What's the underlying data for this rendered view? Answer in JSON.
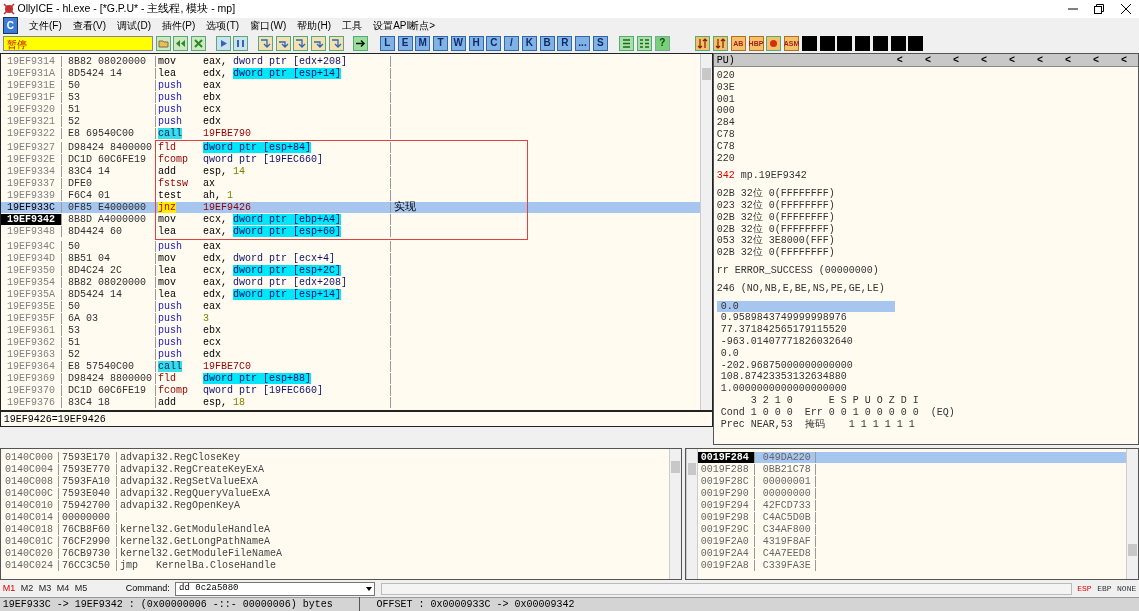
{
  "window": {
    "title": "OllyICE - hl.exe - [*G.P.U* - 主线程, 模块 - mp]"
  },
  "menu": {
    "icon_label": "C",
    "items": [
      "文件(F)",
      "查看(V)",
      "调试(D)",
      "插件(P)",
      "选项(T)",
      "窗口(W)",
      "帮助(H)",
      "工具",
      "设置API断点>"
    ]
  },
  "toolbar": {
    "status": "暂停",
    "letter_buttons": [
      "L",
      "E",
      "M",
      "T",
      "W",
      "H",
      "C",
      "/",
      "K",
      "B",
      "R",
      "...",
      "S"
    ],
    "help_button": "?",
    "plugin_buttons": [
      {
        "kind": "icon"
      },
      {
        "kind": "icon"
      },
      {
        "kind": "text",
        "label": "AB"
      },
      {
        "kind": "text",
        "label": "HBP"
      },
      {
        "kind": "icon"
      },
      {
        "kind": "text",
        "label": "ASM"
      }
    ]
  },
  "disassembly": {
    "rows": [
      {
        "address": "19EF9314",
        "hex": "8B82 08020000",
        "mnemonic": "mov",
        "kind": "plain",
        "operand": [
          {
            "text": "eax, ",
            "kind": "reg"
          },
          {
            "text": "dword ptr [edx+208]",
            "kind": "mem"
          }
        ],
        "selected": false,
        "current": false
      },
      {
        "address": "19EF931A",
        "hex": "8D5424 14",
        "mnemonic": "lea",
        "kind": "plain",
        "operand": [
          {
            "text": "edx, ",
            "kind": "reg"
          },
          {
            "text": "dword ptr [esp+14]",
            "kind": "hl"
          }
        ],
        "selected": false,
        "current": false
      },
      {
        "address": "19EF931E",
        "hex": "50",
        "mnemonic": "push",
        "kind": "push",
        "operand": [
          {
            "text": "eax",
            "kind": "reg"
          }
        ],
        "selected": false,
        "current": false
      },
      {
        "address": "19EF931F",
        "hex": "53",
        "mnemonic": "push",
        "kind": "push",
        "operand": [
          {
            "text": "ebx",
            "kind": "reg"
          }
        ],
        "selected": false,
        "current": false
      },
      {
        "address": "19EF9320",
        "hex": "51",
        "mnemonic": "push",
        "kind": "push",
        "operand": [
          {
            "text": "ecx",
            "kind": "reg"
          }
        ],
        "selected": false,
        "current": false
      },
      {
        "address": "19EF9321",
        "hex": "52",
        "mnemonic": "push",
        "kind": "push",
        "operand": [
          {
            "text": "edx",
            "kind": "reg"
          }
        ],
        "selected": false,
        "current": false
      },
      {
        "address": "19EF9322",
        "hex": "E8 69540C00",
        "mnemonic": "call",
        "kind": "call",
        "operand": [
          {
            "text": "19FBE790",
            "kind": "addr"
          }
        ],
        "selected": false,
        "current": false
      },
      {
        "address": "19EF9327",
        "hex": "D98424 8400000",
        "mnemonic": "fld",
        "kind": "fpu",
        "operand": [
          {
            "text": "dword ptr [esp+84]",
            "kind": "hl"
          }
        ],
        "selected": false,
        "current": false
      },
      {
        "address": "19EF932E",
        "hex": "DC1D 60C6FE19",
        "mnemonic": "fcomp",
        "kind": "fpu",
        "operand": [
          {
            "text": "qword ptr [19FEC660]",
            "kind": "mem"
          }
        ],
        "selected": false,
        "current": false
      },
      {
        "address": "19EF9334",
        "hex": "83C4 14",
        "mnemonic": "add",
        "kind": "plain",
        "operand": [
          {
            "text": "esp, ",
            "kind": "reg"
          },
          {
            "text": "14",
            "kind": "num"
          }
        ],
        "selected": false,
        "current": false
      },
      {
        "address": "19EF9337",
        "hex": "DFE0",
        "mnemonic": "fstsw",
        "kind": "fpu",
        "operand": [
          {
            "text": "ax",
            "kind": "reg"
          }
        ],
        "selected": false,
        "current": false
      },
      {
        "address": "19EF9339",
        "hex": "F6C4 01",
        "mnemonic": "test",
        "kind": "plain",
        "operand": [
          {
            "text": "ah, ",
            "kind": "reg"
          },
          {
            "text": "1",
            "kind": "num"
          }
        ],
        "selected": false,
        "current": false
      },
      {
        "address": "19EF933C",
        "hex": "0F85 E4000000",
        "mnemonic": "jnz",
        "kind": "jump",
        "operand": [
          {
            "text": "19EF9426",
            "kind": "addr"
          }
        ],
        "comment": "实现",
        "selected": true,
        "current": false
      },
      {
        "address": "19EF9342",
        "hex": "8B8D A4000000",
        "mnemonic": "mov",
        "kind": "plain",
        "operand": [
          {
            "text": "ecx, ",
            "kind": "reg"
          },
          {
            "text": "dword ptr [ebp+A4]",
            "kind": "hl"
          }
        ],
        "selected": false,
        "current": true
      },
      {
        "address": "19EF9348",
        "hex": "8D4424 60",
        "mnemonic": "lea",
        "kind": "plain",
        "operand": [
          {
            "text": "eax, ",
            "kind": "reg"
          },
          {
            "text": "dword ptr [esp+60]",
            "kind": "hl"
          }
        ],
        "selected": false,
        "current": false
      },
      {
        "address": "19EF934C",
        "hex": "50",
        "mnemonic": "push",
        "kind": "push",
        "operand": [
          {
            "text": "eax",
            "kind": "reg"
          }
        ],
        "selected": false,
        "current": false
      },
      {
        "address": "19EF934D",
        "hex": "8B51 04",
        "mnemonic": "mov",
        "kind": "plain",
        "operand": [
          {
            "text": "edx, ",
            "kind": "reg"
          },
          {
            "text": "dword ptr [ecx+4]",
            "kind": "mem"
          }
        ],
        "selected": false,
        "current": false
      },
      {
        "address": "19EF9350",
        "hex": "8D4C24 2C",
        "mnemonic": "lea",
        "kind": "plain",
        "operand": [
          {
            "text": "ecx, ",
            "kind": "reg"
          },
          {
            "text": "dword ptr [esp+2C]",
            "kind": "hl"
          }
        ],
        "selected": false,
        "current": false
      },
      {
        "address": "19EF9354",
        "hex": "8B82 08020000",
        "mnemonic": "mov",
        "kind": "plain",
        "operand": [
          {
            "text": "eax, ",
            "kind": "reg"
          },
          {
            "text": "dword ptr [edx+208]",
            "kind": "mem"
          }
        ],
        "selected": false,
        "current": false
      },
      {
        "address": "19EF935A",
        "hex": "8D5424 14",
        "mnemonic": "lea",
        "kind": "plain",
        "operand": [
          {
            "text": "edx, ",
            "kind": "reg"
          },
          {
            "text": "dword ptr [esp+14]",
            "kind": "hl"
          }
        ],
        "selected": false,
        "current": false
      },
      {
        "address": "19EF935E",
        "hex": "50",
        "mnemonic": "push",
        "kind": "push",
        "operand": [
          {
            "text": "eax",
            "kind": "reg"
          }
        ],
        "selected": false,
        "current": false
      },
      {
        "address": "19EF935F",
        "hex": "6A 03",
        "mnemonic": "push",
        "kind": "push",
        "operand": [
          {
            "text": "3",
            "kind": "num"
          }
        ],
        "selected": false,
        "current": false
      },
      {
        "address": "19EF9361",
        "hex": "53",
        "mnemonic": "push",
        "kind": "push",
        "operand": [
          {
            "text": "ebx",
            "kind": "reg"
          }
        ],
        "selected": false,
        "current": false
      },
      {
        "address": "19EF9362",
        "hex": "51",
        "mnemonic": "push",
        "kind": "push",
        "operand": [
          {
            "text": "ecx",
            "kind": "reg"
          }
        ],
        "selected": false,
        "current": false
      },
      {
        "address": "19EF9363",
        "hex": "52",
        "mnemonic": "push",
        "kind": "push",
        "operand": [
          {
            "text": "edx",
            "kind": "reg"
          }
        ],
        "selected": false,
        "current": false
      },
      {
        "address": "19EF9364",
        "hex": "E8 57540C00",
        "mnemonic": "call",
        "kind": "call",
        "operand": [
          {
            "text": "19FBE7C0",
            "kind": "addr"
          }
        ],
        "selected": false,
        "current": false
      },
      {
        "address": "19EF9369",
        "hex": "D98424 8800000",
        "mnemonic": "fld",
        "kind": "fpu",
        "operand": [
          {
            "text": "dword ptr [esp+88]",
            "kind": "hl"
          }
        ],
        "selected": false,
        "current": false
      },
      {
        "address": "19EF9370",
        "hex": "DC1D 60C6FE19",
        "mnemonic": "fcomp",
        "kind": "fpu",
        "operand": [
          {
            "text": "qword ptr [19FEC660]",
            "kind": "mem"
          }
        ],
        "selected": false,
        "current": false
      },
      {
        "address": "19EF9376",
        "hex": "83C4 18",
        "mnemonic": "add",
        "kind": "plain",
        "operand": [
          {
            "text": "esp, ",
            "kind": "reg"
          },
          {
            "text": "18",
            "kind": "num"
          }
        ],
        "selected": false,
        "current": false
      }
    ],
    "info": "19EF9426=19EF9426"
  },
  "registers": {
    "header": "PU)",
    "header_buttons": [
      "<",
      "<",
      "<",
      "<",
      "<",
      "<",
      "<",
      "<",
      "<"
    ],
    "groups": [
      [
        {
          "text": "020"
        },
        {
          "text": "03E"
        },
        {
          "text": "001"
        },
        {
          "text": "000"
        },
        {
          "text": "284"
        },
        {
          "text": "C78"
        },
        {
          "text": "C78"
        },
        {
          "text": "220"
        }
      ],
      [
        {
          "prefix": "342",
          "text": " mp.19EF9342"
        }
      ],
      [
        {
          "text": "02B 32位 0(FFFFFFFF)"
        },
        {
          "text": "023 32位 0(FFFFFFFF)"
        },
        {
          "text": "02B 32位 0(FFFFFFFF)"
        },
        {
          "text": "02B 32位 0(FFFFFFFF)"
        },
        {
          "text": "053 32位 3E8000(FFF)"
        },
        {
          "text": "02B 32位 0(FFFFFFFF)"
        }
      ],
      [
        {
          "text": "rr ERROR_SUCCESS (00000000)"
        }
      ],
      [
        {
          "text": "246 (NO,NB,E,BE,NS,PE,GE,LE)"
        }
      ]
    ],
    "fpu": [
      {
        "value": "0.0",
        "selected": true
      },
      {
        "value": "0.9589843749999998976",
        "selected": false
      },
      {
        "value": "77.371842565179115520",
        "selected": false
      },
      {
        "value": "-963.01407771826032640",
        "selected": false
      },
      {
        "value": "0.0",
        "selected": false
      },
      {
        "value": "-202.96875000000000000",
        "selected": false
      },
      {
        "value": "108.87423353132634880",
        "selected": false
      },
      {
        "value": "1.0000000000000000000",
        "selected": false
      }
    ],
    "status_lines": [
      "     3 2 1 0      E S P U O Z D I",
      "Cond 1 0 0 0  Err 0 0 1 0 0 0 0 0  (EQ)",
      "Prec NEAR,53  掩码    1 1 1 1 1 1"
    ]
  },
  "dump": {
    "rows": [
      {
        "address": "0140C000",
        "value": "7593E170",
        "comment": "advapi32.RegCloseKey"
      },
      {
        "address": "0140C004",
        "value": "7593E770",
        "comment": "advapi32.RegCreateKeyExA"
      },
      {
        "address": "0140C008",
        "value": "7593FA10",
        "comment": "advapi32.RegSetValueExA"
      },
      {
        "address": "0140C00C",
        "value": "7593E040",
        "comment": "advapi32.RegQueryValueExA"
      },
      {
        "address": "0140C010",
        "value": "75942700",
        "comment": "advapi32.RegOpenKeyA"
      },
      {
        "address": "0140C014",
        "value": "00000000"
      },
      {
        "address": "0140C018",
        "value": "76CB8F60",
        "comment": "kernel32.GetModuleHandleA"
      },
      {
        "address": "0140C01C",
        "value": "76CF2990",
        "comment": "kernel32.GetLongPathNameA"
      },
      {
        "address": "0140C020",
        "value": "76CB9730",
        "comment": "kernel32.GetModuleFileNameA"
      },
      {
        "address": "0140C024",
        "value": "76CC3C50",
        "comment": "jmp   KernelBa.CloseHandle"
      }
    ]
  },
  "stack": {
    "rows": [
      {
        "address": "0019F284",
        "value": "049DA220",
        "selected": true
      },
      {
        "address": "0019F288",
        "value": "0BB21C78",
        "selected": false
      },
      {
        "address": "0019F28C",
        "value": "00000001",
        "selected": false
      },
      {
        "address": "0019F290",
        "value": "00000000",
        "selected": false
      },
      {
        "address": "0019F294",
        "value": "42FCD733",
        "selected": false
      },
      {
        "address": "0019F298",
        "value": "C4AC5D0B",
        "selected": false
      },
      {
        "address": "0019F29C",
        "value": "C34AF800",
        "selected": false
      },
      {
        "address": "0019F2A0",
        "value": "4319F8AF",
        "selected": false
      },
      {
        "address": "0019F2A4",
        "value": "C4A7EED8",
        "selected": false
      },
      {
        "address": "0019F2A8",
        "value": "C339FA3E",
        "selected": false
      }
    ]
  },
  "command_bar": {
    "memory_tabs": [
      {
        "label": "M1",
        "selected": true
      },
      {
        "label": "M2",
        "selected": false
      },
      {
        "label": "M3",
        "selected": false
      },
      {
        "label": "M4",
        "selected": false
      },
      {
        "label": "M5",
        "selected": false
      }
    ],
    "label": "Command:",
    "value": "dd 0c2a5080",
    "stack_modes": [
      {
        "label": "ESP",
        "selected": true
      },
      {
        "label": "EBP",
        "selected": false
      },
      {
        "label": "NONE",
        "selected": false
      }
    ]
  },
  "status_bar": {
    "selection": "19EF933C -> 19EF9342 : (0x00000006 -::- 00000006) bytes",
    "offset": "OFFSET : 0x0000933C -> 0x00009342"
  }
}
